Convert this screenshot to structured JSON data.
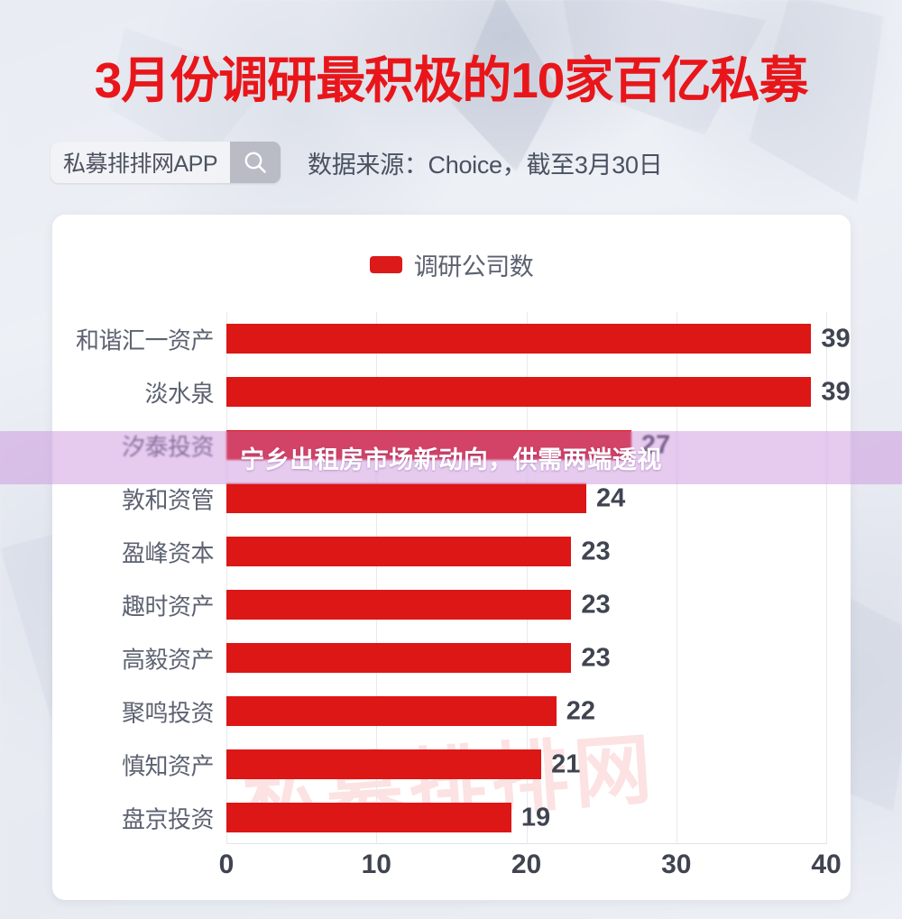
{
  "header": {
    "title": "3月份调研最积极的10家百亿私募",
    "search": {
      "value": "私募排排网APP",
      "icon": "search-icon"
    },
    "data_source": "数据来源：Choice，截至3月30日"
  },
  "card": {
    "watermark": "私募排排网"
  },
  "overlay": {
    "text": "宁乡出租房市场新动向，供需两端透视",
    "color": "#c482da"
  },
  "chart_data": {
    "type": "bar",
    "orientation": "horizontal",
    "title": "3月份调研最积极的10家百亿私募",
    "xlabel": "",
    "ylabel": "",
    "xlim": [
      0,
      40
    ],
    "xticks": [
      "0",
      "10",
      "20",
      "30",
      "40"
    ],
    "grid": true,
    "legend": {
      "position": "top-center",
      "entries": [
        {
          "name": "调研公司数",
          "color": "#dd1616"
        }
      ]
    },
    "bar_color": "#dd1616",
    "categories": [
      "和谐汇一资产",
      "淡水泉",
      "汐泰投资",
      "敦和资管",
      "盈峰资本",
      "趣时资产",
      "高毅资产",
      "聚鸣投资",
      "慎知资产",
      "盘京投资"
    ],
    "series": [
      {
        "name": "调研公司数",
        "values": [
          39,
          39,
          27,
          24,
          23,
          23,
          23,
          22,
          21,
          19
        ]
      }
    ]
  }
}
